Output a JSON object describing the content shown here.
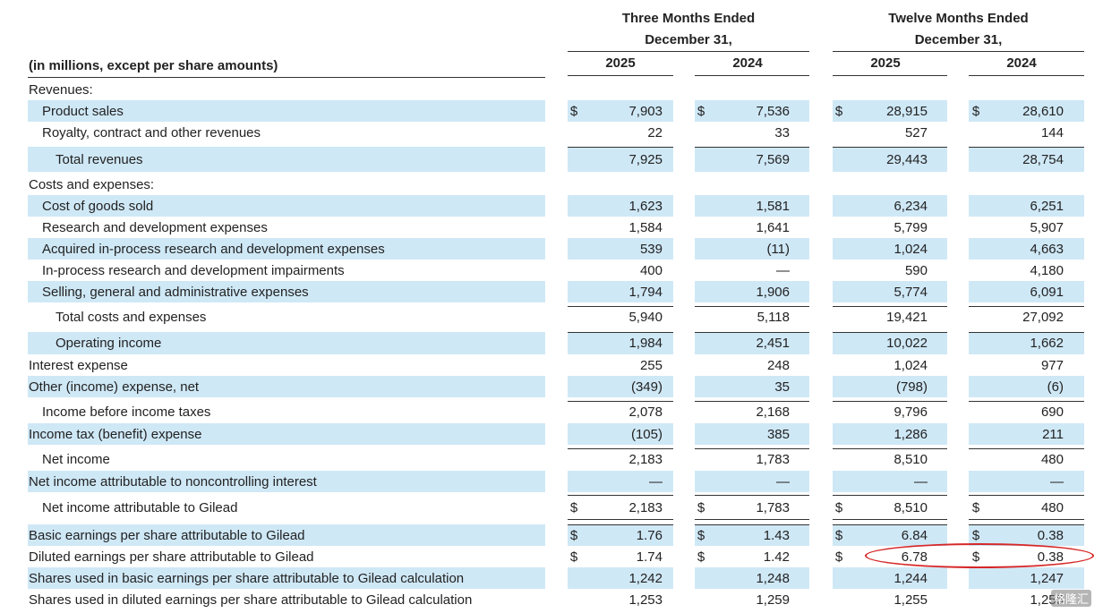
{
  "header": {
    "three_months_line1": "Three Months Ended",
    "three_months_line2": "December 31,",
    "twelve_months_line1": "Twelve Months Ended",
    "twelve_months_line2": "December 31,",
    "units_label": "(in millions, except per share amounts)",
    "years": [
      "2025",
      "2024",
      "2025",
      "2024"
    ]
  },
  "rows": [
    {
      "label": "Revenues:",
      "indent": 0,
      "shade": false,
      "vals": [
        "",
        "",
        "",
        ""
      ]
    },
    {
      "label": "Product sales",
      "indent": 1,
      "shade": true,
      "cur": true,
      "vals": [
        "7,903",
        "7,536",
        "28,915",
        "28,610"
      ]
    },
    {
      "label": "Royalty, contract and other revenues",
      "indent": 1,
      "shade": false,
      "vals": [
        "22",
        "33",
        "527",
        "144"
      ]
    },
    {
      "label": "Total revenues",
      "indent": 2,
      "shade": true,
      "vals": [
        "7,925",
        "7,569",
        "29,443",
        "28,754"
      ]
    },
    {
      "label": "Costs and expenses:",
      "indent": 0,
      "shade": false,
      "vals": [
        "",
        "",
        "",
        ""
      ]
    },
    {
      "label": "Cost of goods sold",
      "indent": 1,
      "shade": true,
      "vals": [
        "1,623",
        "1,581",
        "6,234",
        "6,251"
      ]
    },
    {
      "label": "Research and development expenses",
      "indent": 1,
      "shade": false,
      "vals": [
        "1,584",
        "1,641",
        "5,799",
        "5,907"
      ]
    },
    {
      "label": "Acquired in-process research and development expenses",
      "indent": 1,
      "shade": true,
      "vals": [
        "539",
        "(11)",
        "1,024",
        "4,663"
      ]
    },
    {
      "label": "In-process research and development impairments",
      "indent": 1,
      "shade": false,
      "vals": [
        "400",
        "—",
        "590",
        "4,180"
      ]
    },
    {
      "label": "Selling, general and administrative expenses",
      "indent": 1,
      "shade": true,
      "vals": [
        "1,794",
        "1,906",
        "5,774",
        "6,091"
      ]
    },
    {
      "label": "Total costs and expenses",
      "indent": 2,
      "shade": false,
      "vals": [
        "5,940",
        "5,118",
        "19,421",
        "27,092"
      ]
    },
    {
      "label": "Operating income",
      "indent": 2,
      "shade": true,
      "vals": [
        "1,984",
        "2,451",
        "10,022",
        "1,662"
      ]
    },
    {
      "label": "Interest expense",
      "indent": 0,
      "shade": false,
      "vals": [
        "255",
        "248",
        "1,024",
        "977"
      ]
    },
    {
      "label": "Other (income) expense, net",
      "indent": 0,
      "shade": true,
      "vals": [
        "(349)",
        "35",
        "(798)",
        "(6)"
      ]
    },
    {
      "label": "Income before income taxes",
      "indent": 1,
      "shade": false,
      "vals": [
        "2,078",
        "2,168",
        "9,796",
        "690"
      ]
    },
    {
      "label": "Income tax (benefit) expense",
      "indent": 0,
      "shade": true,
      "vals": [
        "(105)",
        "385",
        "1,286",
        "211"
      ]
    },
    {
      "label": "Net income",
      "indent": 1,
      "shade": false,
      "vals": [
        "2,183",
        "1,783",
        "8,510",
        "480"
      ]
    },
    {
      "label": "Net income attributable to noncontrolling interest",
      "indent": 0,
      "shade": true,
      "vals": [
        "—",
        "—",
        "—",
        "—"
      ]
    },
    {
      "label": "Net income attributable to Gilead",
      "indent": 1,
      "shade": false,
      "cur": true,
      "vals": [
        "2,183",
        "1,783",
        "8,510",
        "480"
      ]
    },
    {
      "label": "Basic earnings per share attributable to Gilead",
      "indent": 0,
      "shade": true,
      "cur": true,
      "vals": [
        "1.76",
        "1.43",
        "6.84",
        "0.38"
      ]
    },
    {
      "label": "Diluted earnings per share attributable to Gilead",
      "indent": 0,
      "shade": false,
      "cur": true,
      "vals": [
        "1.74",
        "1.42",
        "6.78",
        "0.38"
      ]
    },
    {
      "label": "Shares used in basic earnings per share attributable to Gilead calculation",
      "indent": 0,
      "shade": true,
      "vals": [
        "1,242",
        "1,248",
        "1,244",
        "1,247"
      ]
    },
    {
      "label": "Shares used in diluted earnings per share attributable to Gilead calculation",
      "indent": 0,
      "shade": false,
      "vals": [
        "1,253",
        "1,259",
        "1,255",
        "1,255"
      ]
    }
  ],
  "currency_symbol": "$",
  "colors": {
    "band": "#cfe8f6",
    "highlight": "#d62828"
  },
  "watermark": "格隆汇"
}
